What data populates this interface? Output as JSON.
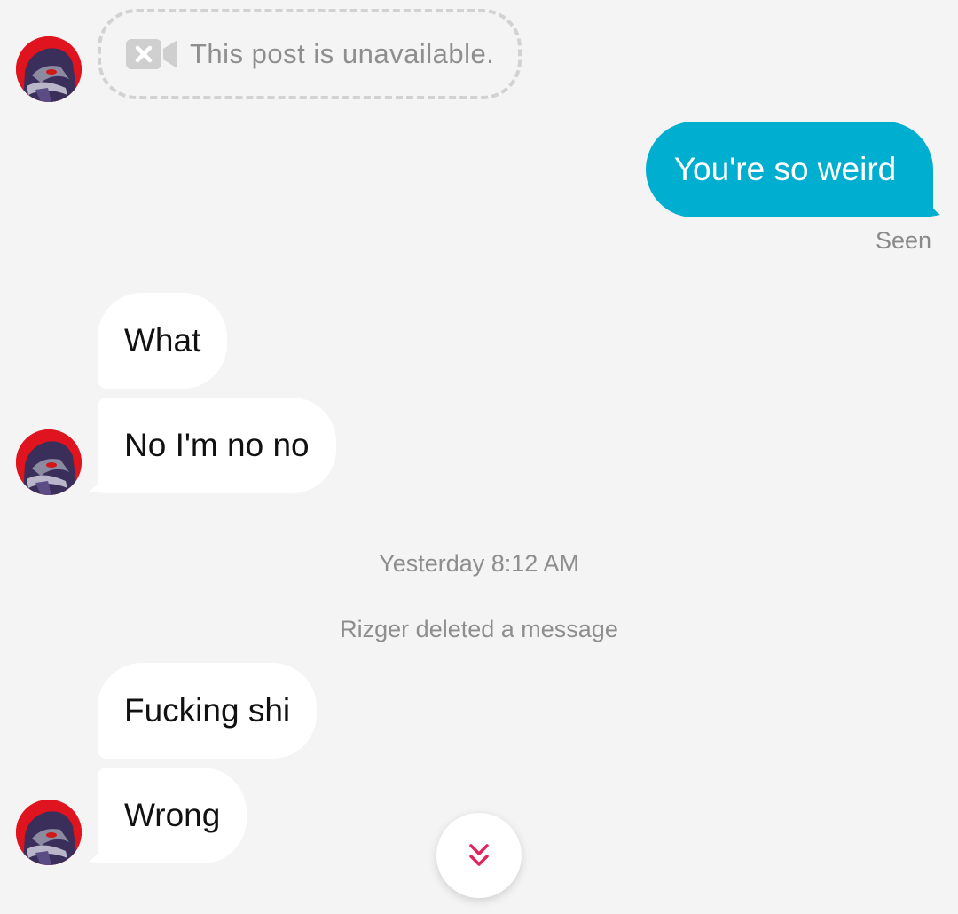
{
  "chat": {
    "unavailable_post": {
      "text": "This post is unavailable.",
      "icon": "video-unavailable-icon"
    },
    "outgoing": {
      "text": "You're so weird",
      "status": "Seen",
      "color": "#00aed0"
    },
    "group1": [
      "What",
      "No I'm no no"
    ],
    "timestamp": "Yesterday 8:12 AM",
    "deleted_notice": "Rizger deleted a message",
    "group2": [
      "Fucking shi",
      "Wrong"
    ]
  },
  "scroll_button": {
    "icon": "double-chevron-down-icon",
    "color": "#e0245e"
  }
}
